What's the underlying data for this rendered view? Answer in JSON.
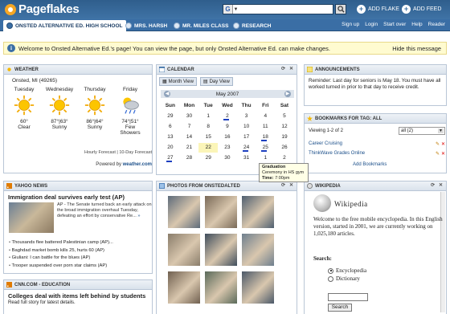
{
  "header": {
    "logo": "Pageflakes",
    "search_engine_glyph": "G",
    "search_placeholder": "",
    "add_flake": "ADD FLAKE",
    "add_feed": "ADD FEED"
  },
  "tabs": [
    {
      "label": "ONSTED ALTERNATIVE ED. HIGH SCHOOL",
      "active": true
    },
    {
      "label": "MRS. HARSH",
      "active": false
    },
    {
      "label": "MR. MILES CLASS",
      "active": false
    },
    {
      "label": "RESEARCH",
      "active": false
    }
  ],
  "toplinks": [
    "Sign up",
    "Login",
    "Start over",
    "Help",
    "Reader"
  ],
  "notice": {
    "text": "Welcome to Onsted Alternative Ed.'s page! You can view the page, but only Onsted Alternative Ed. can make changes.",
    "hide": "Hide this message"
  },
  "weather": {
    "title": "WEATHER",
    "location": "Onsted, MI (49265)",
    "days": [
      {
        "day": "Tuesday",
        "temp": "60°",
        "cond": "Clear",
        "icon": "sun-icon"
      },
      {
        "day": "Wednesday",
        "temp": "87°|63°",
        "cond": "Sunny",
        "icon": "sun-icon"
      },
      {
        "day": "Thursday",
        "temp": "86°|64°",
        "cond": "Sunny",
        "icon": "sun-icon"
      },
      {
        "day": "Friday",
        "temp": "74°|51°",
        "cond": "Few Showers",
        "icon": "rain-cloud-icon"
      }
    ],
    "forecast_links": "Hourly Forecast | 10-Day Forecast",
    "powered": "Powered by",
    "powered_brand": "weather.com"
  },
  "yahoo_news": {
    "title": "YAHOO NEWS",
    "headline": "Immigration deal survives early test (AP)",
    "summary": "AP - The Senate turned back an early attack on the broad immigration overhaul Tuesday, defeating an effort by conservative Re...",
    "items": [
      "Thousands flee battered Palestinian camp (AP)...",
      "Baghdad market bomb kills 25, hurts 60 (AP)",
      "Giuliani: I can battle for the blues (AP)",
      "Trooper suspended over porn star claims (AP)"
    ]
  },
  "cnn": {
    "title": "CNN.COM - EDUCATION",
    "headline": "Colleges deal with items left behind by students",
    "teaser": "Read full story for latest details."
  },
  "calendar": {
    "title": "CALENDAR",
    "month_view": "Month View",
    "day_view": "Day View",
    "month": "May 2007",
    "weekdays": [
      "Sun",
      "Mon",
      "Tue",
      "Wed",
      "Thu",
      "Fri",
      "Sat"
    ],
    "weeks": [
      [
        "29",
        "30",
        "1",
        "2",
        "3",
        "4",
        "5"
      ],
      [
        "6",
        "7",
        "8",
        "9",
        "10",
        "11",
        "12"
      ],
      [
        "13",
        "14",
        "15",
        "16",
        "17",
        "18",
        "19"
      ],
      [
        "20",
        "21",
        "22",
        "23",
        "24",
        "25",
        "26"
      ],
      [
        "27",
        "28",
        "29",
        "30",
        "31",
        "1",
        "2"
      ]
    ],
    "events": [
      "0-3",
      "2-5",
      "3-4",
      "3-5",
      "4-0"
    ],
    "today": "3-2",
    "tooltip": {
      "title": "Graduation",
      "line1": "Ceremony in HS gym",
      "time_label": "Time:",
      "time": "7:00pm"
    }
  },
  "photos": {
    "title": "PHOTOS FROM ONSTEDALTED"
  },
  "announcements": {
    "title": "ANNOUNCEMENTS",
    "text": "Reminder: Last day for seniors is May 18. You must have all worked turned in prior to that day to receive credit."
  },
  "bookmarks": {
    "title": "BOOKMARKS FOR TAG: ALL",
    "viewing": "Viewing 1-2 of 2",
    "select_value": "all (2)",
    "items": [
      "Career Cruising",
      "ThinkWave Grades Online"
    ],
    "add_link": "Add Bookmarks"
  },
  "wikipedia": {
    "title": "WIKIPEDIA",
    "logo": "Wikipedia",
    "text": "Welcome to the free mobile encyclopedia. In this English version, started in 2001, we are currently working on 1,025,180 articles.",
    "search_label": "Search:",
    "opt1": "Encyclopedia",
    "opt2": "Dictionary",
    "button": "Search"
  }
}
